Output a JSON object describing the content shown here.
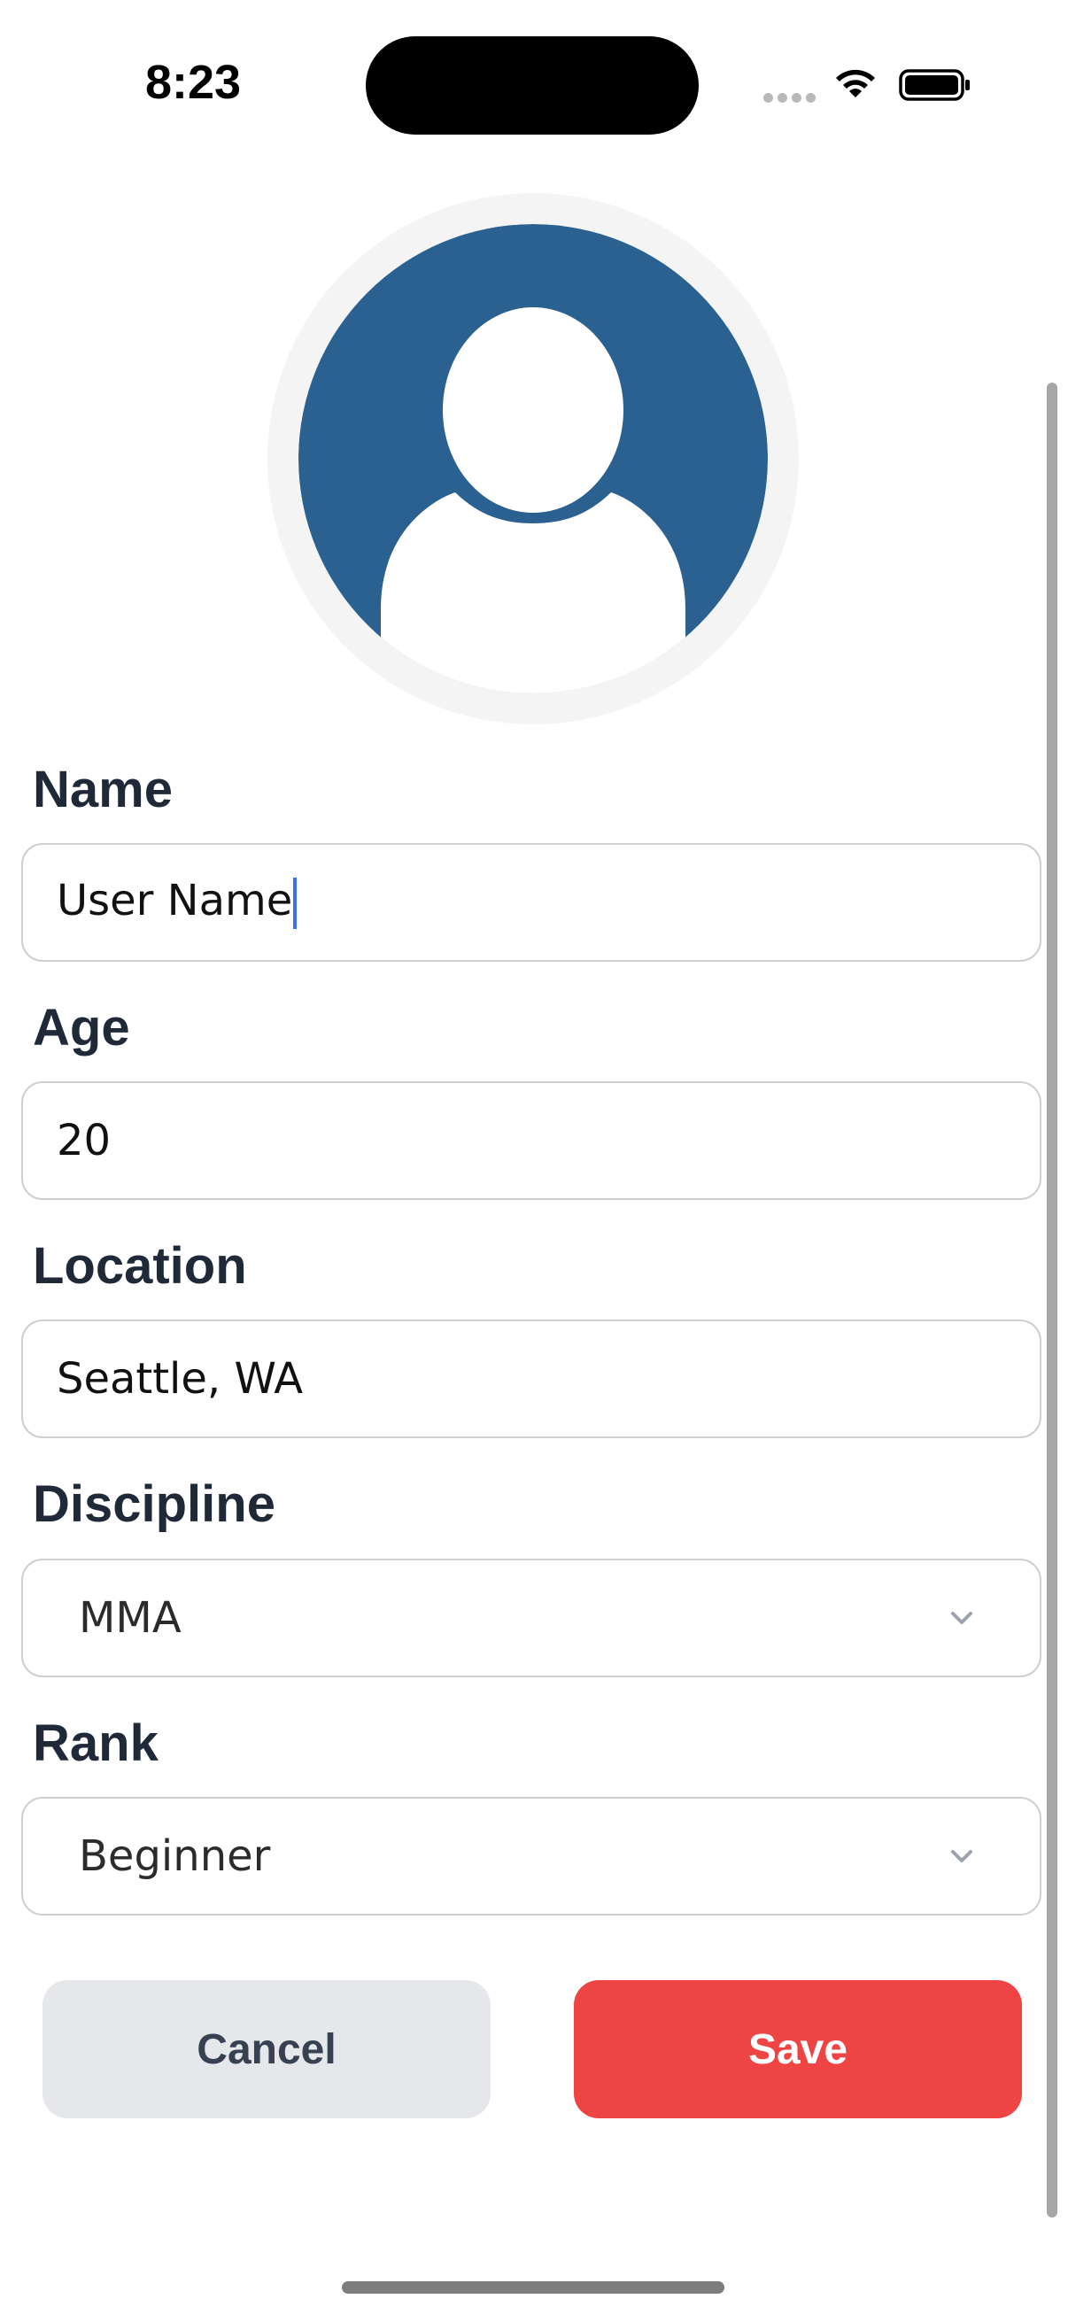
{
  "status_bar": {
    "time": "8:23",
    "icons": [
      "cellular-icon",
      "wifi-icon",
      "battery-icon"
    ]
  },
  "avatar": {
    "icon": "user-placeholder-icon",
    "color": "#2b6190"
  },
  "form": {
    "name": {
      "label": "Name",
      "value": "User Name"
    },
    "age": {
      "label": "Age",
      "value": "20"
    },
    "location": {
      "label": "Location",
      "value": "Seattle, WA"
    },
    "discipline": {
      "label": "Discipline",
      "selected": "MMA"
    },
    "rank": {
      "label": "Rank",
      "selected": "Beginner"
    }
  },
  "actions": {
    "cancel_label": "Cancel",
    "save_label": "Save"
  },
  "colors": {
    "save": "#ef4444",
    "cancel": "#e5e7eb",
    "label": "#1f2937",
    "caret": "#3b6ef5"
  }
}
